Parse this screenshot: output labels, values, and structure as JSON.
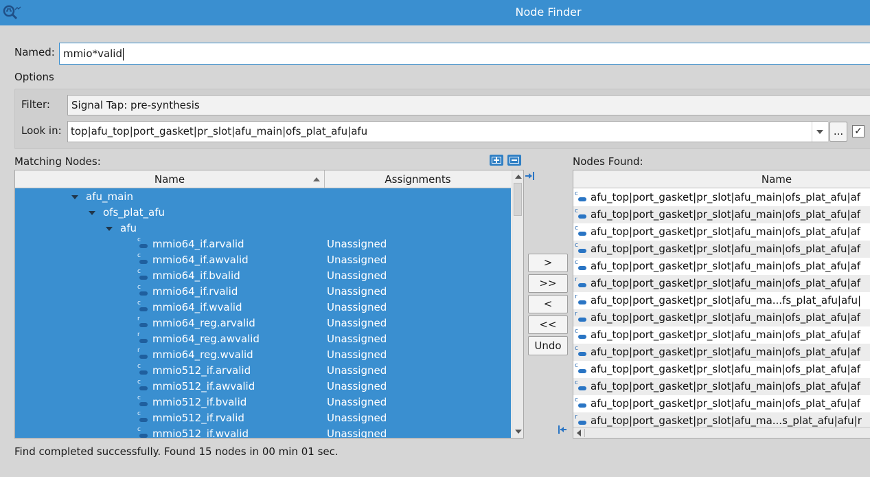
{
  "window": {
    "title": "Node Finder"
  },
  "named": {
    "label": "Named:",
    "value": "mmio*valid"
  },
  "options": {
    "label": "Options",
    "filter_label": "Filter:",
    "filter_value": "Signal Tap: pre-synthesis",
    "lookin_label": "Look in:",
    "lookin_value": "top|afu_top|port_gasket|pr_slot|afu_main|ofs_plat_afu|afu",
    "browse_label": "...",
    "include_subentities_checked": "✓"
  },
  "matching": {
    "label": "Matching Nodes:",
    "col_name": "Name",
    "col_assignments": "Assignments",
    "tree": [
      {
        "label": "afu_main",
        "level": 0
      },
      {
        "label": "ofs_plat_afu",
        "level": 1
      },
      {
        "label": "afu",
        "level": 2
      }
    ],
    "nodes": [
      {
        "name": "mmio64_if.arvalid",
        "type": "c",
        "assignment": "Unassigned"
      },
      {
        "name": "mmio64_if.awvalid",
        "type": "c",
        "assignment": "Unassigned"
      },
      {
        "name": "mmio64_if.bvalid",
        "type": "c",
        "assignment": "Unassigned"
      },
      {
        "name": "mmio64_if.rvalid",
        "type": "c",
        "assignment": "Unassigned"
      },
      {
        "name": "mmio64_if.wvalid",
        "type": "c",
        "assignment": "Unassigned"
      },
      {
        "name": "mmio64_reg.arvalid",
        "type": "r",
        "assignment": "Unassigned"
      },
      {
        "name": "mmio64_reg.awvalid",
        "type": "r",
        "assignment": "Unassigned"
      },
      {
        "name": "mmio64_reg.wvalid",
        "type": "r",
        "assignment": "Unassigned"
      },
      {
        "name": "mmio512_if.arvalid",
        "type": "c",
        "assignment": "Unassigned"
      },
      {
        "name": "mmio512_if.awvalid",
        "type": "c",
        "assignment": "Unassigned"
      },
      {
        "name": "mmio512_if.bvalid",
        "type": "c",
        "assignment": "Unassigned"
      },
      {
        "name": "mmio512_if.rvalid",
        "type": "c",
        "assignment": "Unassigned"
      },
      {
        "name": "mmio512_if.wvalid",
        "type": "c",
        "assignment": "Unassigned"
      }
    ]
  },
  "transfer": {
    "add_one": ">",
    "add_all": ">>",
    "remove_one": "<",
    "remove_all": "<<",
    "undo": "Undo"
  },
  "found": {
    "label": "Nodes Found:",
    "col_name": "Name",
    "rows": [
      {
        "type": "c",
        "name": "afu_top|port_gasket|pr_slot|afu_main|ofs_plat_afu|af"
      },
      {
        "type": "c",
        "name": "afu_top|port_gasket|pr_slot|afu_main|ofs_plat_afu|af"
      },
      {
        "type": "c",
        "name": "afu_top|port_gasket|pr_slot|afu_main|ofs_plat_afu|af"
      },
      {
        "type": "c",
        "name": "afu_top|port_gasket|pr_slot|afu_main|ofs_plat_afu|af"
      },
      {
        "type": "c",
        "name": "afu_top|port_gasket|pr_slot|afu_main|ofs_plat_afu|af"
      },
      {
        "type": "r",
        "name": "afu_top|port_gasket|pr_slot|afu_main|ofs_plat_afu|af"
      },
      {
        "type": "r",
        "name": "afu_top|port_gasket|pr_slot|afu_ma...fs_plat_afu|afu|"
      },
      {
        "type": "r",
        "name": "afu_top|port_gasket|pr_slot|afu_main|ofs_plat_afu|af"
      },
      {
        "type": "c",
        "name": "afu_top|port_gasket|pr_slot|afu_main|ofs_plat_afu|af"
      },
      {
        "type": "c",
        "name": "afu_top|port_gasket|pr_slot|afu_main|ofs_plat_afu|af"
      },
      {
        "type": "c",
        "name": "afu_top|port_gasket|pr_slot|afu_main|ofs_plat_afu|af"
      },
      {
        "type": "c",
        "name": "afu_top|port_gasket|pr_slot|afu_main|ofs_plat_afu|af"
      },
      {
        "type": "c",
        "name": "afu_top|port_gasket|pr_slot|afu_main|ofs_plat_afu|af"
      },
      {
        "type": "r",
        "name": "afu_top|port_gasket|pr_slot|afu_ma...s_plat_afu|afu|r"
      }
    ]
  },
  "status": "Find completed successfully. Found 15 nodes in 00 min 01 sec.",
  "colors": {
    "accent": "#3a8fd0",
    "selection": "#3a8fd0",
    "signal_icon": "#2a75c4"
  }
}
